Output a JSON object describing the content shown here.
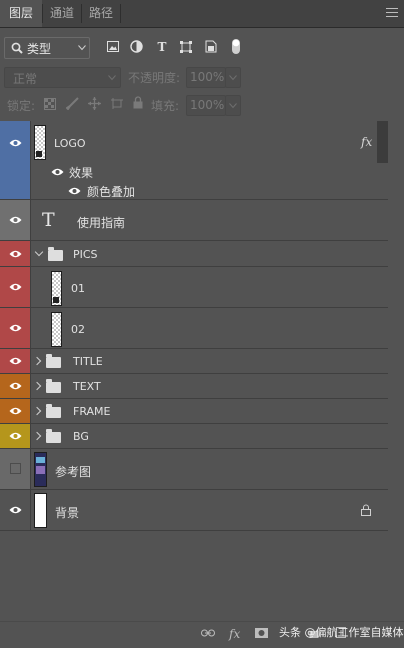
{
  "tabs": [
    {
      "label": "图层",
      "active": true
    },
    {
      "label": "通道",
      "active": false
    },
    {
      "label": "路径",
      "active": false
    }
  ],
  "filter": {
    "selected": "类型",
    "icons": [
      "image-filter-icon",
      "adjustment-filter-icon",
      "text-filter-icon",
      "shape-filter-icon",
      "smart-object-filter-icon",
      "filter-toggle-icon"
    ]
  },
  "blend": {
    "mode": "正常",
    "opacity_label": "不透明度:",
    "opacity_value": "100%"
  },
  "lock": {
    "label": "锁定:",
    "fill_label": "填充:",
    "fill_value": "100%"
  },
  "layers": [
    {
      "name": "LOGO",
      "color": "#4f6fa4",
      "fx": "fx"
    },
    {
      "effects_label": "效果",
      "effect_item": "颜色叠加"
    },
    {
      "name": "使用指南",
      "color": "#707070",
      "type_glyph": "T"
    },
    {
      "name": "PICS",
      "color": "#b04848"
    },
    {
      "name": "01",
      "color": "#b04848"
    },
    {
      "name": "02",
      "color": "#b04848"
    },
    {
      "name": "TITLE",
      "color": "#b04848"
    },
    {
      "name": "TEXT",
      "color": "#b5661c"
    },
    {
      "name": "FRAME",
      "color": "#b5661c"
    },
    {
      "name": "BG",
      "color": "#b5961c"
    },
    {
      "name": "参考图",
      "color": "#696969"
    },
    {
      "name": "背景",
      "color": "#535353"
    }
  ],
  "bottom": {
    "icons": [
      "link-layers-icon",
      "fx-icon",
      "mask-icon"
    ],
    "fx": "fx",
    "watermark": "头条 @偏航工作室自媒体"
  }
}
